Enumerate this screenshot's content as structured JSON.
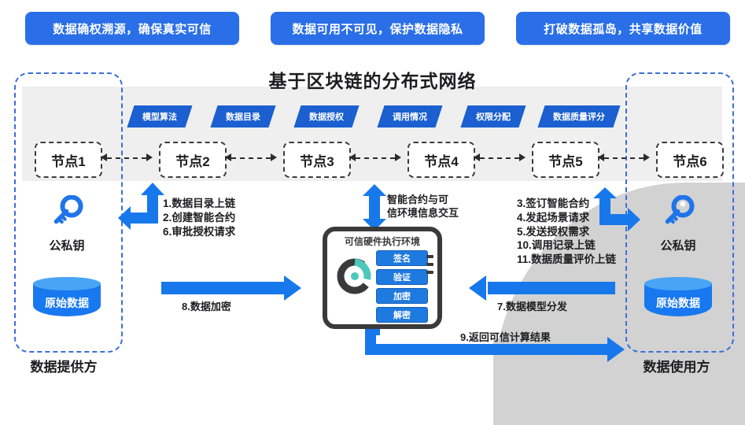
{
  "banner": {
    "pills": [
      "数据确权溯源，确保真实可信",
      "数据可用不可见，保护数据隐私",
      "打破数据孤岛，共享数据价值"
    ]
  },
  "network": {
    "title": "基于区块链的分布式网络",
    "tags": [
      "模型算法",
      "数据目录",
      "数据授权",
      "调用情况",
      "权限分配",
      "数据质量评分"
    ],
    "nodes": [
      "节点1",
      "节点2",
      "节点3",
      "节点4",
      "节点5",
      "节点6"
    ]
  },
  "provider": {
    "label": "数据提供方",
    "key_icon": "key-icon",
    "key_label": "公私钥",
    "database_label": "原始数据"
  },
  "consumer": {
    "label": "数据使用方",
    "key_icon": "key-icon",
    "key_label": "公私钥",
    "database_label": "原始数据"
  },
  "tee": {
    "title": "可信硬件执行环境",
    "caption_line1": "智能合约与可",
    "caption_line2": "信环境信息交互",
    "buttons": [
      "签名",
      "验证",
      "加密",
      "解密"
    ]
  },
  "steps": {
    "left": [
      "1.数据目录上链",
      "2.创建智能合约",
      "6.审批授权请求"
    ],
    "right": [
      "3.签订智能合约",
      "4.发起场景请求",
      "5.发送授权需求",
      "10.调用记录上链",
      "11.数据质量评价上链"
    ]
  },
  "flows": {
    "encrypt": "8.数据加密",
    "distribute": "7.数据模型分发",
    "result": "9.返回可信计算结果"
  },
  "colors": {
    "brand_blue": "#2a6fe8",
    "tag_blue": "#1b5fd0",
    "arrow_blue": "#1778ec",
    "db_blue": "#1878f0",
    "band_gray": "#efefef",
    "blob_gray": "#d2d2d2",
    "dark": "#3a3a3a"
  }
}
